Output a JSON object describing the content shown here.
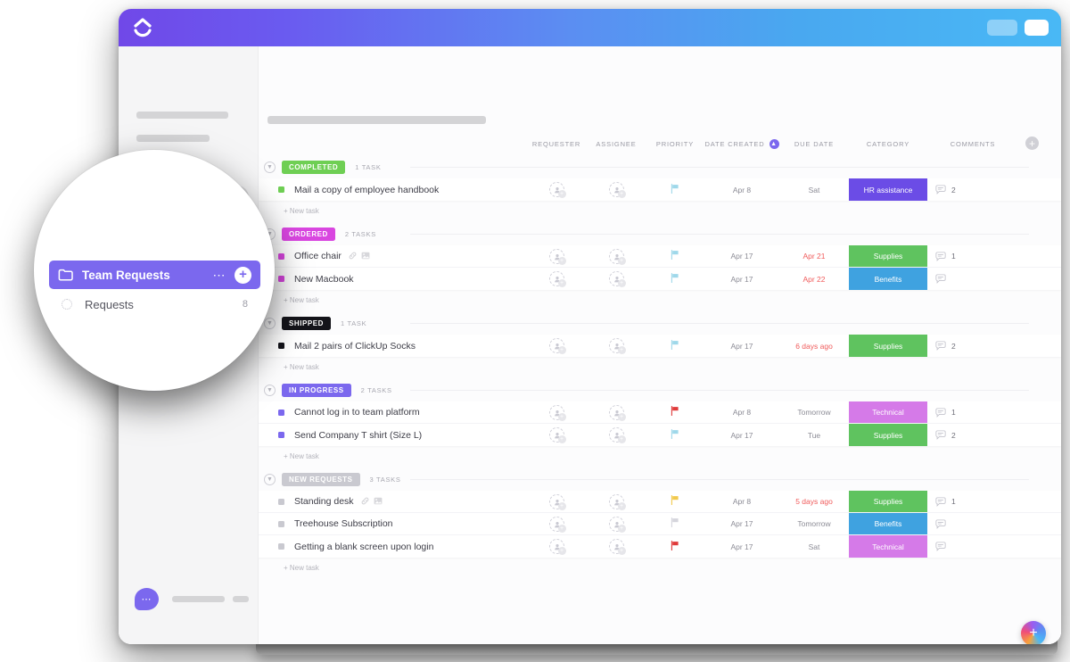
{
  "app": {
    "logo_icon": "clickup-logo-icon",
    "topbar_controls": [
      "window-pill-muted",
      "window-pill-light"
    ]
  },
  "magnifier": {
    "folder_icon": "folder-icon",
    "folder_label": "Team Requests",
    "menu_icon": "ellipsis-icon",
    "add_icon": "plus-icon",
    "list_status_icon": "list-loading-icon",
    "list_label": "Requests",
    "list_count": "8"
  },
  "sidebar": {
    "chat_icon": "chat-bubble-icon"
  },
  "table": {
    "headers": {
      "name": "",
      "requester": "REQUESTER",
      "assignee": "ASSIGNEE",
      "priority": "PRIORITY",
      "date_created": "DATE CREATED",
      "due_date": "DUE DATE",
      "category": "CATEGORY",
      "comments": "COMMENTS",
      "sort_icon": "sort-ascending-icon",
      "add_column_icon": "add-column-icon"
    },
    "new_task_label": "+ New task",
    "groups": [
      {
        "status": "COMPLETED",
        "status_color": "#6fcf54",
        "count_label": "1 TASK",
        "chevron_icon": "chevron-down-icon",
        "tasks": [
          {
            "title": "Mail a copy of employee handbook",
            "dot_color": "#6fcf54",
            "icons": [],
            "requester_icon": "add-assignee-icon",
            "assignee_icon": "add-assignee-icon",
            "priority": "low",
            "priority_color": "#9fd8ea",
            "date_created": "Apr 8",
            "due_date": "Sat",
            "due_overdue": false,
            "category": "HR assistance",
            "category_color": "#6b4ce6",
            "comments_icon": "comment-icon",
            "comments": "2"
          }
        ]
      },
      {
        "status": "ORDERED",
        "status_color": "#d946e0",
        "count_label": "2 TASKS",
        "chevron_icon": "chevron-down-icon",
        "tasks": [
          {
            "title": "Office chair",
            "dot_color": "#d946e0",
            "icons": [
              "link-icon",
              "attachment-image-icon"
            ],
            "requester_icon": "add-assignee-icon",
            "assignee_icon": "add-assignee-icon",
            "priority": "low",
            "priority_color": "#9fd8ea",
            "date_created": "Apr 17",
            "due_date": "Apr 21",
            "due_overdue": true,
            "category": "Supplies",
            "category_color": "#5fc35f",
            "comments_icon": "comment-icon",
            "comments": "1"
          },
          {
            "title": "New Macbook",
            "dot_color": "#d946e0",
            "icons": [],
            "requester_icon": "add-assignee-icon",
            "assignee_icon": "add-assignee-icon",
            "priority": "low",
            "priority_color": "#9fd8ea",
            "date_created": "Apr 17",
            "due_date": "Apr 22",
            "due_overdue": true,
            "category": "Benefits",
            "category_color": "#3fa2e0",
            "comments_icon": "comment-icon",
            "comments": ""
          }
        ]
      },
      {
        "status": "SHIPPED",
        "status_color": "#14141a",
        "count_label": "1 TASK",
        "chevron_icon": "chevron-down-icon",
        "tasks": [
          {
            "title": "Mail 2 pairs of ClickUp Socks",
            "dot_color": "#14141a",
            "icons": [],
            "requester_icon": "add-assignee-icon",
            "assignee_icon": "add-assignee-icon",
            "priority": "low",
            "priority_color": "#9fd8ea",
            "date_created": "Apr 17",
            "due_date": "6 days ago",
            "due_overdue": true,
            "category": "Supplies",
            "category_color": "#5fc35f",
            "comments_icon": "comment-icon",
            "comments": "2"
          }
        ]
      },
      {
        "status": "IN PROGRESS",
        "status_color": "#7b68ee",
        "count_label": "2 TASKS",
        "chevron_icon": "chevron-down-icon",
        "tasks": [
          {
            "title": "Cannot log in to team platform",
            "dot_color": "#7b68ee",
            "icons": [],
            "requester_icon": "add-assignee-icon",
            "assignee_icon": "add-assignee-icon",
            "priority": "urgent",
            "priority_color": "#e03b3b",
            "date_created": "Apr 8",
            "due_date": "Tomorrow",
            "due_overdue": false,
            "category": "Technical",
            "category_color": "#d57ae8",
            "comments_icon": "comment-icon",
            "comments": "1"
          },
          {
            "title": "Send Company T shirt (Size L)",
            "dot_color": "#7b68ee",
            "icons": [],
            "requester_icon": "add-assignee-icon",
            "assignee_icon": "add-assignee-icon",
            "priority": "low",
            "priority_color": "#9fd8ea",
            "date_created": "Apr 17",
            "due_date": "Tue",
            "due_overdue": false,
            "category": "Supplies",
            "category_color": "#5fc35f",
            "comments_icon": "comment-icon",
            "comments": "2"
          }
        ]
      },
      {
        "status": "NEW REQUESTS",
        "status_color": "#c9c9d0",
        "count_label": "3 TASKS",
        "chevron_icon": "chevron-down-icon",
        "tasks": [
          {
            "title": "Standing desk",
            "dot_color": "#c9c9d0",
            "icons": [
              "link-icon",
              "attachment-image-icon"
            ],
            "requester_icon": "add-assignee-icon",
            "assignee_icon": "add-assignee-icon",
            "priority": "high",
            "priority_color": "#f2c94c",
            "date_created": "Apr 8",
            "due_date": "5 days ago",
            "due_overdue": true,
            "category": "Supplies",
            "category_color": "#5fc35f",
            "comments_icon": "comment-icon",
            "comments": "1"
          },
          {
            "title": "Treehouse Subscription",
            "dot_color": "#c9c9d0",
            "icons": [],
            "requester_icon": "add-assignee-icon",
            "assignee_icon": "add-assignee-icon",
            "priority": "none",
            "priority_color": "#d5d5dc",
            "date_created": "Apr 17",
            "due_date": "Tomorrow",
            "due_overdue": false,
            "category": "Benefits",
            "category_color": "#3fa2e0",
            "comments_icon": "comment-icon",
            "comments": ""
          },
          {
            "title": "Getting a blank screen upon login",
            "dot_color": "#c9c9d0",
            "icons": [],
            "requester_icon": "add-assignee-icon",
            "assignee_icon": "add-assignee-icon",
            "priority": "urgent",
            "priority_color": "#e03b3b",
            "date_created": "Apr 17",
            "due_date": "Sat",
            "due_overdue": false,
            "category": "Technical",
            "category_color": "#d57ae8",
            "comments_icon": "comment-icon",
            "comments": ""
          }
        ]
      }
    ]
  },
  "fab": {
    "icon": "plus-icon"
  }
}
